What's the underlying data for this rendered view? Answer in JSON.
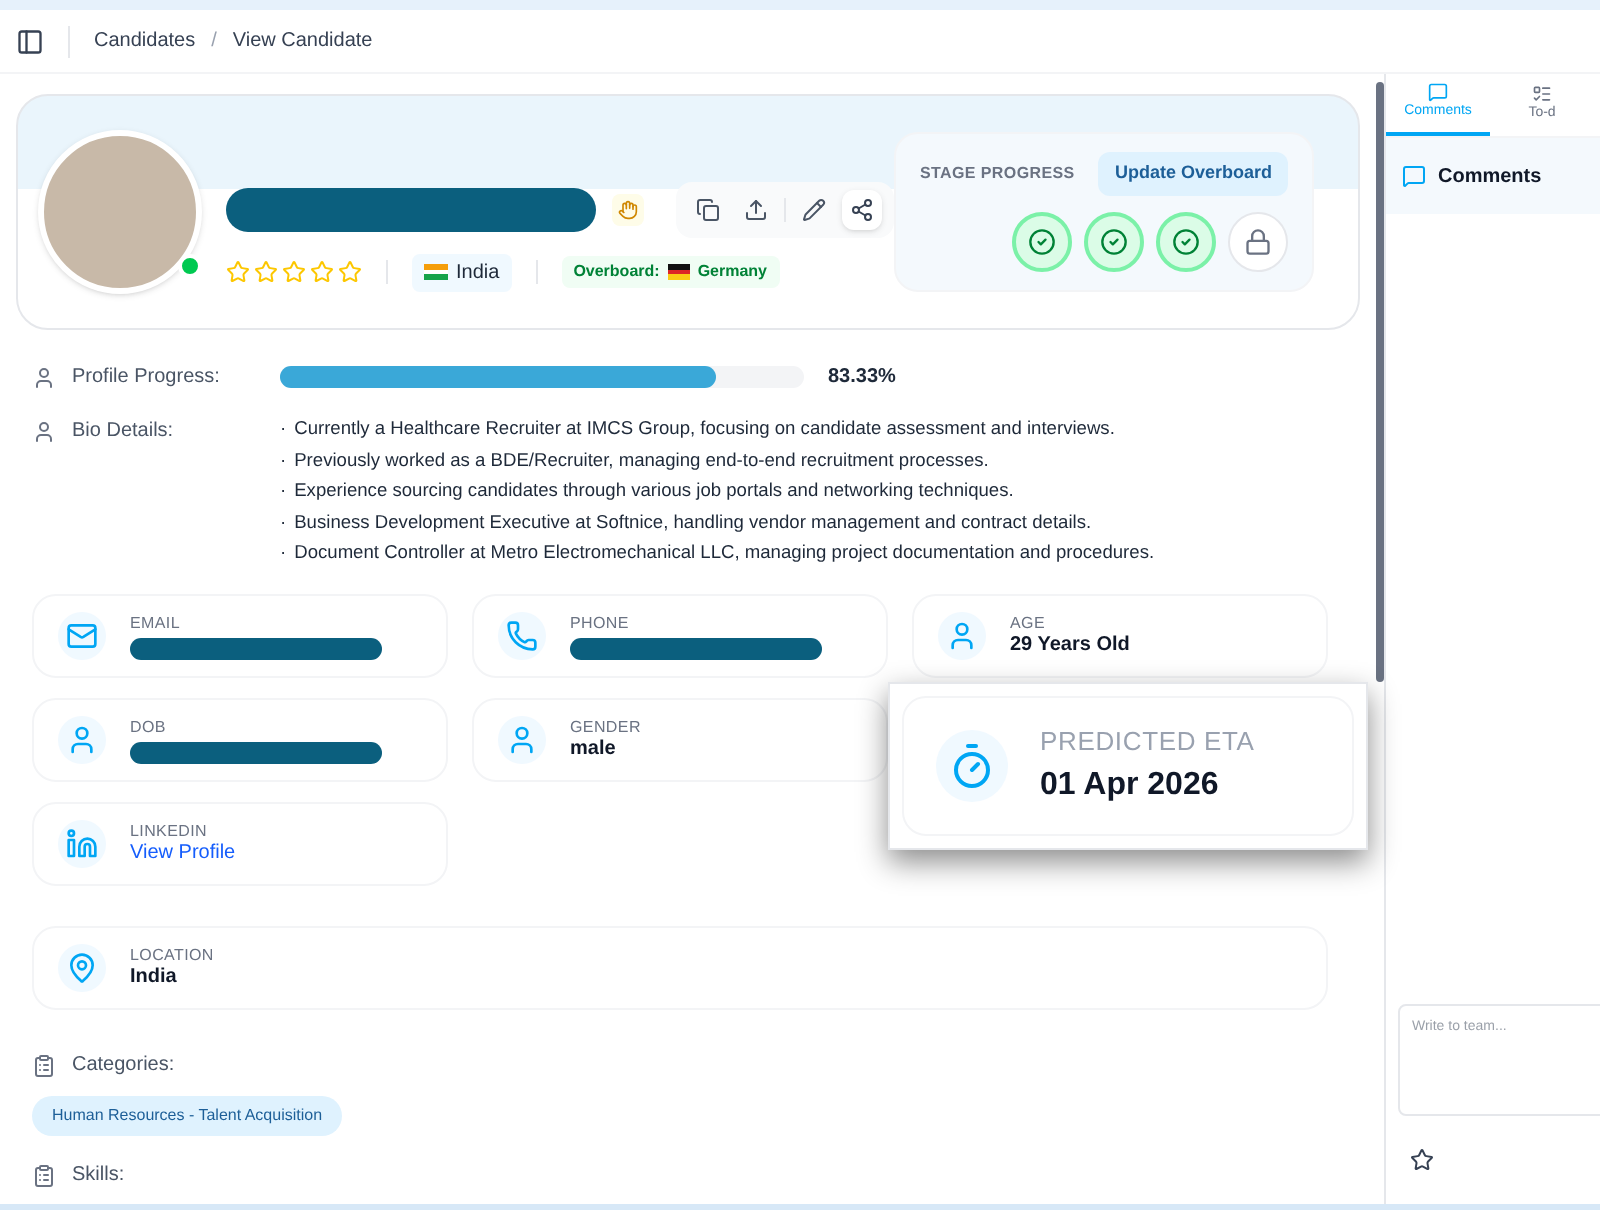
{
  "breadcrumb": [
    "Candidates",
    "View Candidate"
  ],
  "breadcrumb_separator": "/",
  "profile": {
    "stars": 0,
    "country": "India",
    "overboard_label": "Overboard:",
    "overboard_country": "Germany"
  },
  "stage_progress": {
    "title": "STAGE PROGRESS",
    "button": "Update Overboard",
    "stages": [
      {
        "kind": "done"
      },
      {
        "kind": "done"
      },
      {
        "kind": "done"
      },
      {
        "kind": "locked"
      }
    ]
  },
  "profile_progress": {
    "label": "Profile Progress:",
    "level": 0.8333,
    "reading": "83.33%"
  },
  "bio": {
    "label": "Bio Details:",
    "bullet": "·",
    "items": [
      "Currently a Healthcare Recruiter at IMCS Group, focusing on candidate assessment and interviews.",
      "Previously worked as a BDE/Recruiter, managing end-to-end recruitment processes.",
      "Experience sourcing candidates through various job portals and networking techniques.",
      "Business Development Executive at Softnice, handling vendor management and contract details.",
      "Document Controller at Metro Electromechanical LLC, managing project documentation and procedures."
    ]
  },
  "details": [
    {
      "kind": "email",
      "label": "EMAIL",
      "redacted": true
    },
    {
      "kind": "phone",
      "label": "PHONE",
      "redacted": true
    },
    {
      "kind": "person",
      "label": "AGE",
      "value": "29 Years Old"
    },
    {
      "kind": "person",
      "label": "DOB",
      "redacted": true
    },
    {
      "kind": "person",
      "label": "GENDER",
      "value": "male"
    },
    {
      "kind": "eta",
      "label": "PREDICTED ETA",
      "value": "01 Apr 2026"
    },
    {
      "kind": "linkedin",
      "label": "LINKEDIN",
      "link": "View Profile"
    }
  ],
  "location": {
    "label": "LOCATION",
    "value": "India"
  },
  "categories": {
    "label": "Categories:",
    "tags": [
      "Human Resources - Talent Acquisition"
    ]
  },
  "skills": {
    "label": "Skills:"
  },
  "side_panel": {
    "tabs": [
      {
        "label": "Comments",
        "selected": true
      },
      {
        "label": "To-d",
        "selected": false
      }
    ],
    "title": "Comments",
    "placeholder": "Write to team..."
  }
}
